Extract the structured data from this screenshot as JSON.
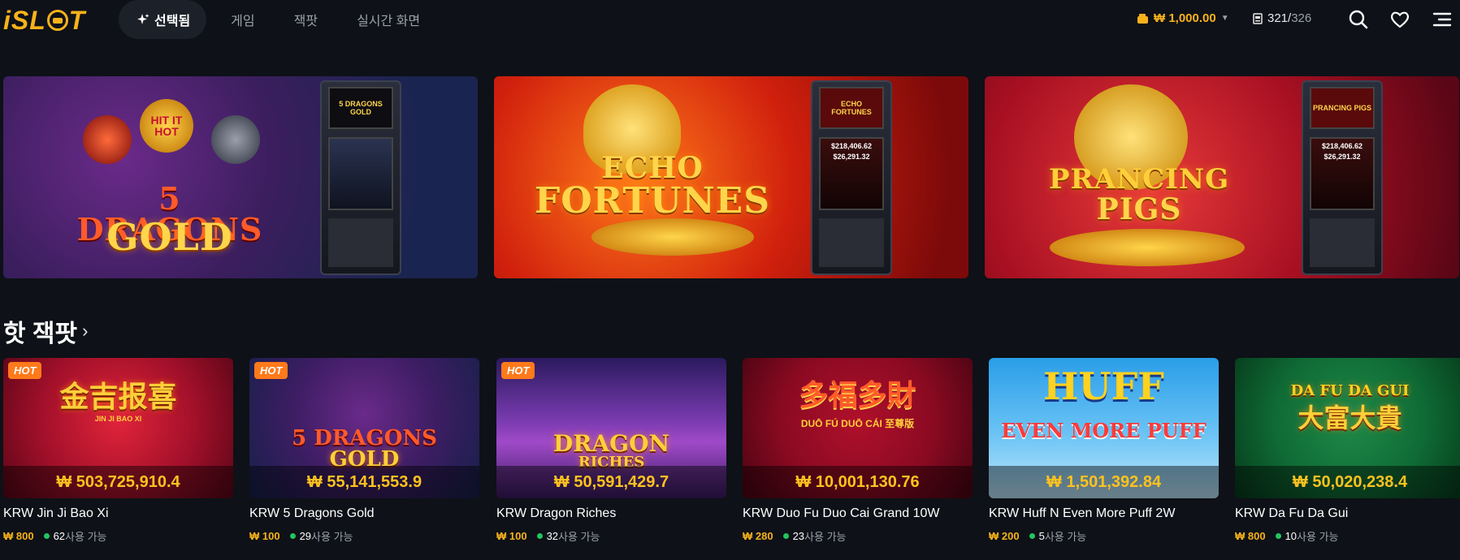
{
  "brand": {
    "logo": "iSLOT",
    "accent": "#f7b21b"
  },
  "nav": {
    "selected": "선택됨",
    "items": [
      "게임",
      "잭팟",
      "실시간 화면"
    ]
  },
  "header": {
    "balance": "₩ 1,000.00",
    "players_current": "321",
    "players_sep": "/",
    "players_max": "326"
  },
  "banners": [
    {
      "title_line1": "5 DRAGONS",
      "title_line2": "GOLD",
      "badge": "HIT IT HOT",
      "screen_title": "5 DRAGONS GOLD"
    },
    {
      "title_line1": "ECHO",
      "title_line2": "FORTUNES",
      "screen_title": "ECHO FORTUNES",
      "meter1": "$218,406.62",
      "meter2": "$26,291.32"
    },
    {
      "title_line1": "PRANCING",
      "title_line2": "PIGS",
      "screen_title": "PRANCING PIGS",
      "meter1": "$218,406.62",
      "meter2": "$26,291.32"
    }
  ],
  "section": {
    "title": "핫 잭팟",
    "chevron": "›"
  },
  "games": [
    {
      "hot": "HOT",
      "art_title": "金吉报喜",
      "art_sub": "JIN JI BAO XI",
      "jackpot": "₩ 503,725,910.4",
      "name": "KRW Jin Ji Bao Xi",
      "bet": "₩ 800",
      "available": "62",
      "available_label": "사용 가능"
    },
    {
      "hot": "HOT",
      "art_title": "5 DRAGONS",
      "art_sub": "GOLD",
      "jackpot": "₩ 55,141,553.9",
      "name": "KRW 5 Dragons Gold",
      "bet": "₩ 100",
      "available": "29",
      "available_label": "사용 가능"
    },
    {
      "hot": "HOT",
      "art_title": "DRAGON",
      "art_sub": "RICHES",
      "jackpot": "₩ 50,591,429.7",
      "name": "KRW Dragon Riches",
      "bet": "₩ 100",
      "available": "32",
      "available_label": "사용 가능"
    },
    {
      "hot": "",
      "art_title": "多福多財",
      "art_sub": "DUŌ FÚ DUŌ CÁI 至尊版",
      "jackpot": "₩ 10,001,130.76",
      "name": "KRW Duo Fu Duo Cai Grand 10W",
      "bet": "₩ 280",
      "available": "23",
      "available_label": "사용 가능"
    },
    {
      "hot": "",
      "art_title": "HUFF",
      "art_sub": "EVEN MORE PUFF",
      "jackpot": "₩ 1,501,392.84",
      "name": "KRW Huff N Even More Puff 2W",
      "bet": "₩ 200",
      "available": "5",
      "available_label": "사용 가능"
    },
    {
      "hot": "",
      "art_title": "DA FU DA GUI",
      "art_sub": "大富大貴",
      "jackpot": "₩ 50,020,238.4",
      "name": "KRW Da Fu Da Gui",
      "bet": "₩ 800",
      "available": "10",
      "available_label": "사용 가능"
    }
  ]
}
